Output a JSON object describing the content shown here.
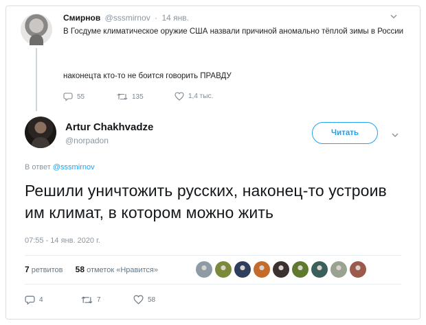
{
  "parent": {
    "name": "Смирнов",
    "handle": "@sssmirnov",
    "separator": "·",
    "date": "14 янв.",
    "text": "В Госдуме климатическое оружие США назвали причиной аномально тёплой зимы в России",
    "text2": "наконецта кто-то не боится говорить ПРАВДУ",
    "replies": "55",
    "retweets": "135",
    "likes": "1,4 тыс."
  },
  "tweet": {
    "name": "Artur Chakhvadze",
    "handle": "@norpadon",
    "follow_label": "Читать",
    "reply_prefix": "В ответ",
    "reply_mention": "@sssmirnov",
    "text": "Решили уничтожить русских, наконец-то устроив им климат, в котором можно жить",
    "timestamp": "07:55 - 14 янв. 2020 г.",
    "retweet_count": "7",
    "retweet_label": "ретвитов",
    "like_count": "58",
    "like_label": "отметок «Нравится»",
    "replies": "4",
    "retweets": "7",
    "likes": "58"
  },
  "likers": [
    {
      "icon": "avatar-gray",
      "color": "#8e9aa6"
    },
    {
      "icon": "avatar-olive",
      "color": "#7a8a3a"
    },
    {
      "icon": "avatar-navy",
      "color": "#2f3e5c"
    },
    {
      "icon": "avatar-orange",
      "color": "#c46a2a"
    },
    {
      "icon": "avatar-slim",
      "color": "#3a3230"
    },
    {
      "icon": "avatar-green",
      "color": "#5f7a2e"
    },
    {
      "icon": "avatar-teal",
      "color": "#3b5f5a"
    },
    {
      "icon": "avatar-flower",
      "color": "#9aa38f"
    },
    {
      "icon": "avatar-portrait",
      "color": "#9c5a4c"
    }
  ],
  "colors": {
    "accent": "#1da1f2",
    "muted": "#8a96a2"
  }
}
